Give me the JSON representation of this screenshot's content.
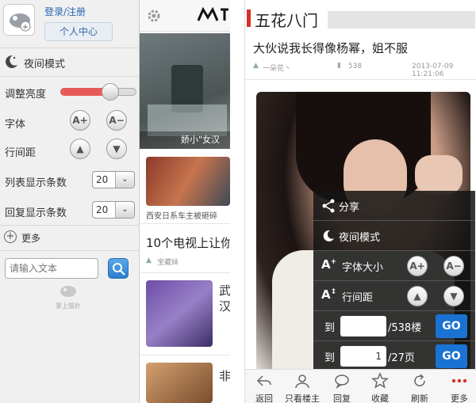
{
  "left": {
    "login_link": "登录/注册",
    "personal_center": "个人中心",
    "night_mode": "夜间模式",
    "brightness_label": "调整亮度",
    "brightness_level": 0.7,
    "font_label": "字体",
    "line_spacing_label": "行间距",
    "list_count_label": "列表显示条数",
    "list_count_value": "20",
    "reply_count_label": "回复显示条数",
    "reply_count_value": "20",
    "more_label": "更多",
    "search_placeholder": "请输入文本",
    "bottom_logo_text": "掌上猫扑"
  },
  "mid": {
    "caption1": "娇小\"女汉",
    "caption2": "西安日系车主被砸碎",
    "title3": "10个电视上让你",
    "author3": "宝藏妹",
    "partial1": "武",
    "partial2": "汉",
    "partial3": "非"
  },
  "right": {
    "board_title": "五花八门",
    "post_title": "大伙说我长得像杨幂，姐不服",
    "author": "一朵花丶",
    "comments": "538",
    "time": "2013-07-09 11:21:06",
    "menu": {
      "share": "分享",
      "night": "夜间模式",
      "font_size": "字体大小",
      "line_spacing": "行间距",
      "to_label": "到",
      "floor_total": "/538楼",
      "page_value": "1",
      "page_total": "/27页",
      "go": "GO"
    },
    "toolbar": {
      "back": "返回",
      "only_op": "只看楼主",
      "reply": "回复",
      "favorite": "收藏",
      "refresh": "刷新",
      "more": "更多"
    }
  },
  "colors": {
    "accent_blue": "#1a73d2",
    "brand_red": "#d9302a",
    "slider_red": "#e85a5a"
  }
}
